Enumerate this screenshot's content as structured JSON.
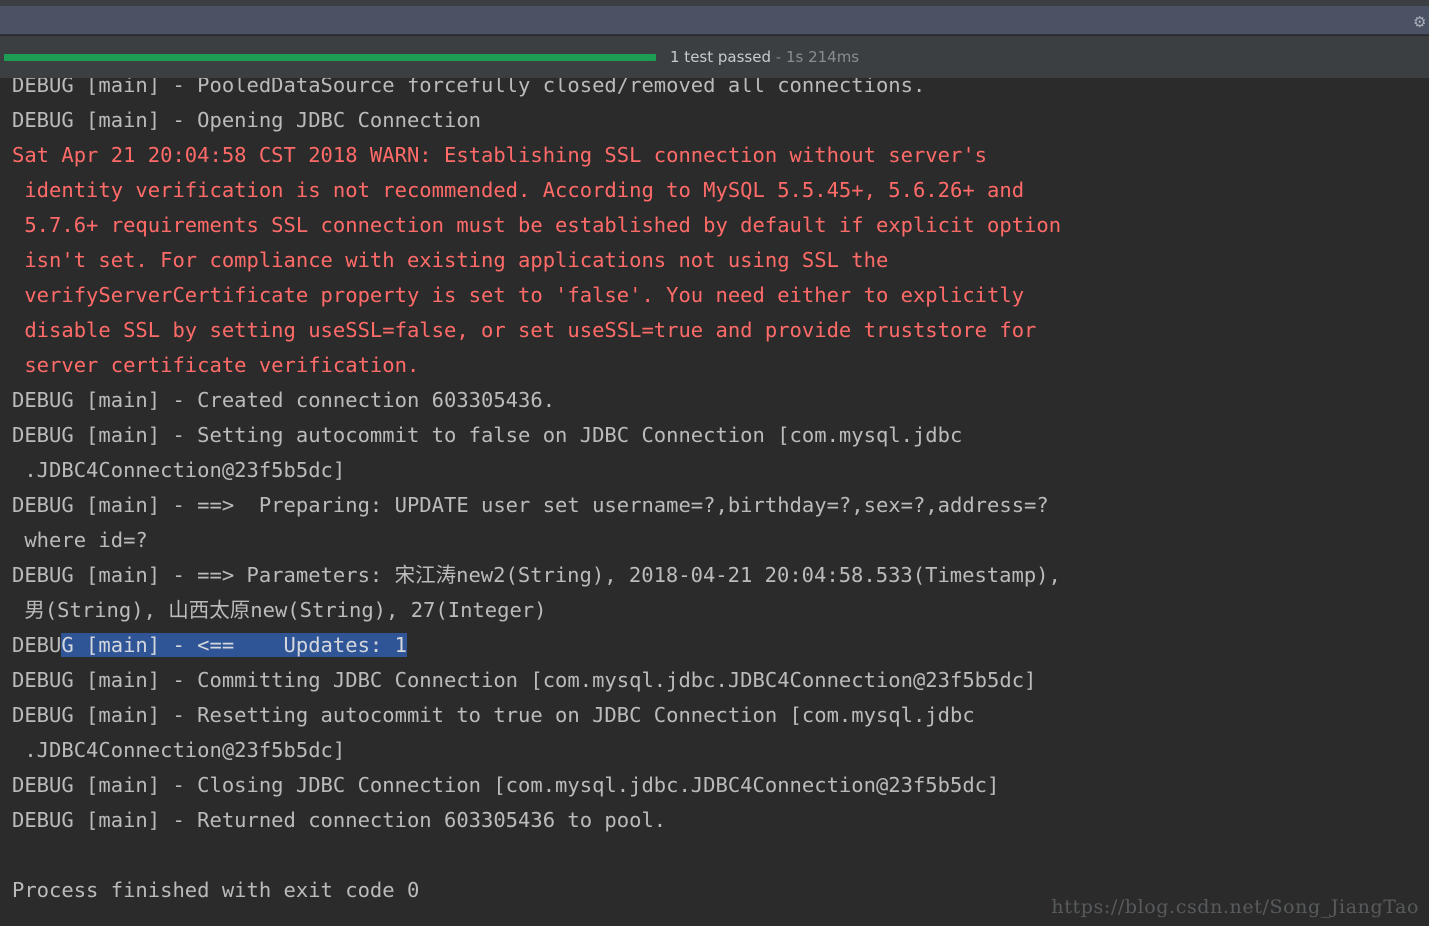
{
  "window": {
    "background_color": "#2b2b2b",
    "toolbar_color": "#4b5263",
    "gear_icon": "gear-icon"
  },
  "status": {
    "progress_percent": 46,
    "progress_color": "#1e9e54",
    "passed_text": "1 test passed",
    "separator": " - ",
    "duration": "1s 214ms"
  },
  "console": {
    "selection_color": "#2f5597",
    "debug_color": "#bbbbbb",
    "warn_color": "#ff6b68",
    "lines": [
      {
        "text": "DEBUG [main] - PooledDataSource forcefully closed/removed all connections.",
        "type": "debug"
      },
      {
        "text": "DEBUG [main] - Opening JDBC Connection",
        "type": "debug"
      },
      {
        "text": "Sat Apr 21 20:04:58 CST 2018 WARN: Establishing SSL connection without server's",
        "type": "warn"
      },
      {
        "text": " identity verification is not recommended. According to MySQL 5.5.45+, 5.6.26+ and",
        "type": "warn"
      },
      {
        "text": " 5.7.6+ requirements SSL connection must be established by default if explicit option",
        "type": "warn"
      },
      {
        "text": " isn't set. For compliance with existing applications not using SSL the",
        "type": "warn"
      },
      {
        "text": " verifyServerCertificate property is set to 'false'. You need either to explicitly",
        "type": "warn"
      },
      {
        "text": " disable SSL by setting useSSL=false, or set useSSL=true and provide truststore for",
        "type": "warn"
      },
      {
        "text": " server certificate verification.",
        "type": "warn"
      },
      {
        "text": "DEBUG [main] - Created connection 603305436.",
        "type": "debug"
      },
      {
        "text": "DEBUG [main] - Setting autocommit to false on JDBC Connection [com.mysql.jdbc",
        "type": "debug"
      },
      {
        "text": " .JDBC4Connection@23f5b5dc]",
        "type": "debug"
      },
      {
        "text": "DEBUG [main] - ==>  Preparing: UPDATE user set username=?,birthday=?,sex=?,address=?",
        "type": "debug"
      },
      {
        "text": " where id=?",
        "type": "debug"
      },
      {
        "text": "DEBUG [main] - ==> Parameters: 宋江涛new2(String), 2018-04-21 20:04:58.533(Timestamp),",
        "type": "debug"
      },
      {
        "text": " 男(String), 山西太原new(String), 27(Integer)",
        "type": "debug"
      },
      {
        "text": "DEBUG [main] - <==    Updates: 1",
        "type": "debug",
        "selected": true,
        "selection_start": 4
      },
      {
        "text": "DEBUG [main] - Committing JDBC Connection [com.mysql.jdbc.JDBC4Connection@23f5b5dc]",
        "type": "debug"
      },
      {
        "text": "DEBUG [main] - Resetting autocommit to true on JDBC Connection [com.mysql.jdbc",
        "type": "debug"
      },
      {
        "text": " .JDBC4Connection@23f5b5dc]",
        "type": "debug"
      },
      {
        "text": "DEBUG [main] - Closing JDBC Connection [com.mysql.jdbc.JDBC4Connection@23f5b5dc]",
        "type": "debug"
      },
      {
        "text": "DEBUG [main] - Returned connection 603305436 to pool.",
        "type": "debug"
      },
      {
        "text": "",
        "type": "blank"
      },
      {
        "text": "Process finished with exit code 0",
        "type": "out"
      }
    ]
  },
  "watermark": {
    "url": "https://blog.csdn.net/Song_JiangTao"
  }
}
